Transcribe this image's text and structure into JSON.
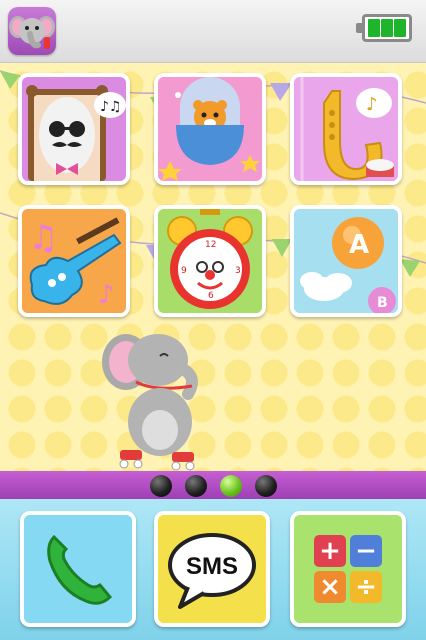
{
  "header": {
    "avatar_icon": "elephant-face-icon",
    "battery": {
      "cells": 3,
      "max_cells": 3,
      "color": "#1eb52a"
    }
  },
  "apps": [
    {
      "name": "tile-mr-white-portrait",
      "icon": "white-gentleman-portrait-icon",
      "bg": "#d98ce2"
    },
    {
      "name": "tile-tiger-capsule",
      "icon": "tiger-capsule-icon",
      "bg": "#f2a6d4"
    },
    {
      "name": "tile-saxophone",
      "icon": "saxophone-drum-icon",
      "bg": "#e3a9e8"
    },
    {
      "name": "tile-guitar",
      "icon": "electric-guitar-icon",
      "bg": "#f7a64a"
    },
    {
      "name": "tile-alarm-clock",
      "icon": "clown-alarm-clock-icon",
      "bg": "#a8dd6a"
    },
    {
      "name": "tile-abc-balloons",
      "icon": "letter-balloons-icon",
      "bg": "#a6dff0"
    }
  ],
  "pager": {
    "pages": 4,
    "active": 3
  },
  "dock": {
    "phone": {
      "icon": "phone-handset-icon"
    },
    "sms": {
      "icon": "sms-bubble-icon",
      "label": "SMS"
    },
    "calculator": {
      "icon": "calculator-icon",
      "symbols": [
        "+",
        "−",
        "×",
        "÷"
      ]
    }
  },
  "colors": {
    "strip": "#b24fc6",
    "dock": "#9adff2",
    "wallpaper": "#fff3b4"
  }
}
